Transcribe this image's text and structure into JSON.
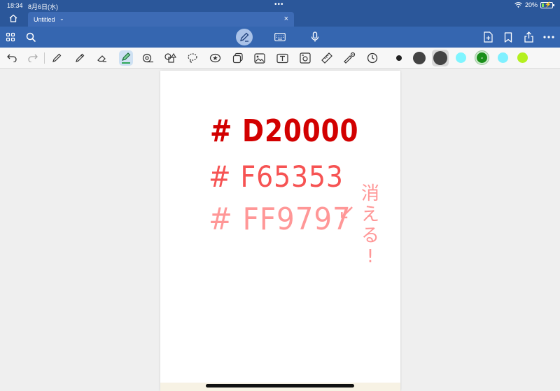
{
  "status": {
    "time": "18:34",
    "date": "8月6日(水)",
    "dots": "•••",
    "battery": "20%",
    "battery_level": 0.2
  },
  "tab": {
    "title": "Untitled",
    "chevron": "⌄",
    "close": "×"
  },
  "appbar": {
    "icons": [
      "grid-icon",
      "search-icon",
      "pen-mode-icon",
      "keyboard-icon",
      "microphone-icon",
      "add-page-icon",
      "bookmark-icon",
      "share-icon",
      "more-icon"
    ]
  },
  "toolbar": {
    "tools": [
      "undo-icon",
      "redo-icon",
      "pen-icon",
      "pencil-icon",
      "eraser-icon",
      "highlighter-icon",
      "tape-icon",
      "shapes-icon",
      "lasso-icon",
      "sticker-icon",
      "element-icon",
      "image-icon",
      "text-icon",
      "camera-icon",
      "ruler-icon",
      "laser-icon",
      "clock-icon"
    ],
    "colors": {
      "dot_small": "#222222",
      "dot_medium": "#444444",
      "dot_large": "#444444",
      "cyan1": "#7ff5ff",
      "green": "#1a8f1a",
      "cyan2": "#7ff0ff",
      "lime": "#b4f020"
    }
  },
  "canvas": {
    "line1": "# D20000",
    "line2": "# F65353",
    "line3": "# FF9797",
    "arrow": "↙",
    "note_chars": [
      "消",
      "え",
      "る",
      "!"
    ],
    "colors": {
      "line1": "#d20000",
      "line2": "#f65353",
      "line3": "#ff9797"
    }
  }
}
